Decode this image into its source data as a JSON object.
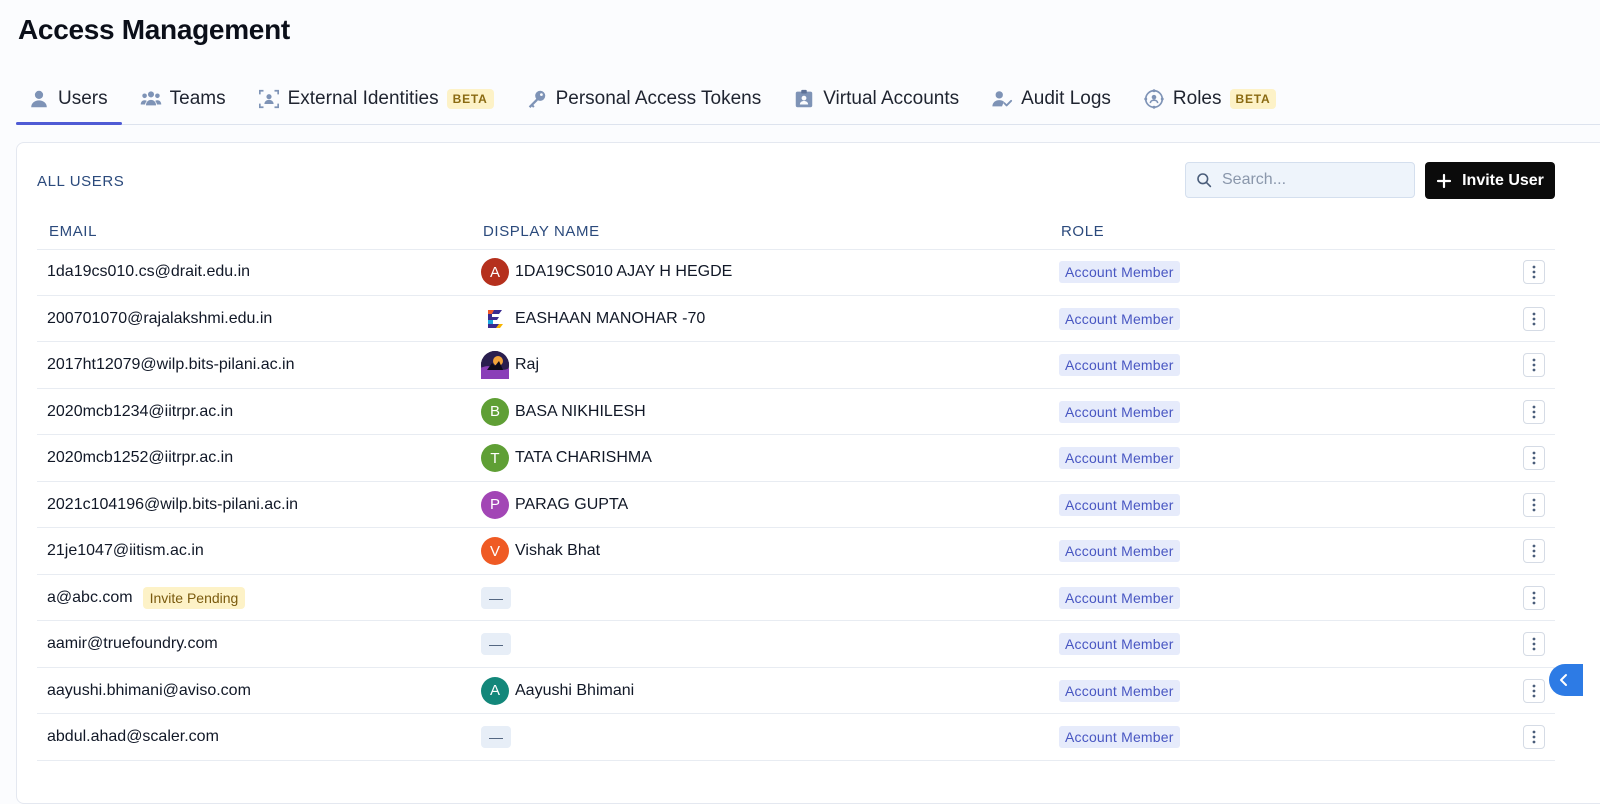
{
  "header": {
    "title": "Access Management"
  },
  "tabs": [
    {
      "label": "Users",
      "icon": "user-icon",
      "active": true
    },
    {
      "label": "Teams",
      "icon": "team-icon",
      "active": false
    },
    {
      "label": "External Identities",
      "icon": "external-identities-icon",
      "badge": "BETA",
      "active": false
    },
    {
      "label": "Personal Access Tokens",
      "icon": "key-icon",
      "active": false
    },
    {
      "label": "Virtual Accounts",
      "icon": "id-badge-icon",
      "active": false
    },
    {
      "label": "Audit Logs",
      "icon": "user-check-icon",
      "active": false
    },
    {
      "label": "Roles",
      "icon": "roles-icon",
      "badge": "BETA",
      "active": false
    }
  ],
  "users": {
    "section_label": "ALL USERS",
    "search_placeholder": "Search...",
    "invite_label": "Invite User",
    "columns": {
      "email": "EMAIL",
      "display_name": "DISPLAY NAME",
      "role": "ROLE"
    },
    "rows": [
      {
        "email": "1da19cs010.cs@drait.edu.in",
        "display_name": "1DA19CS010 AJAY H HEGDE",
        "avatar": "A",
        "avatar_color": "#b5301d",
        "role": "Account Member"
      },
      {
        "email": "200701070@rajalakshmi.edu.in",
        "display_name": "EASHAAN MANOHAR -70",
        "avatar_type": "logo-icon",
        "role": "Account Member"
      },
      {
        "email": "2017ht12079@wilp.bits-pilani.ac.in",
        "display_name": "Raj",
        "avatar_type": "photo-icon",
        "role": "Account Member"
      },
      {
        "email": "2020mcb1234@iitrpr.ac.in",
        "display_name": "BASA NIKHILESH",
        "avatar": "B",
        "avatar_color": "#5f9f35",
        "role": "Account Member"
      },
      {
        "email": "2020mcb1252@iitrpr.ac.in",
        "display_name": "TATA CHARISHMA",
        "avatar": "T",
        "avatar_color": "#5f9f35",
        "role": "Account Member"
      },
      {
        "email": "2021c104196@wilp.bits-pilani.ac.in",
        "display_name": "PARAG GUPTA",
        "avatar": "P",
        "avatar_color": "#a246b5",
        "role": "Account Member"
      },
      {
        "email": "21je1047@iitism.ac.in",
        "display_name": "Vishak Bhat",
        "avatar": "V",
        "avatar_color": "#ef5a24",
        "role": "Account Member"
      },
      {
        "email": "a@abc.com",
        "status": "Invite Pending",
        "display_name": "—",
        "role": "Account Member"
      },
      {
        "email": "aamir@truefoundry.com",
        "display_name": "—",
        "role": "Account Member"
      },
      {
        "email": "aayushi.bhimani@aviso.com",
        "display_name": "Aayushi Bhimani",
        "avatar": "A",
        "avatar_color": "#13877a",
        "role": "Account Member"
      },
      {
        "email": "abdul.ahad@scaler.com",
        "display_name": "—",
        "role": "Account Member"
      }
    ]
  },
  "colors": {
    "accent": "#4f5bd5",
    "role_badge_bg": "#e6ebfb",
    "role_badge_text": "#4856c2",
    "beta_bg": "#fdf2c7",
    "side_toggle": "#2d7be5"
  }
}
